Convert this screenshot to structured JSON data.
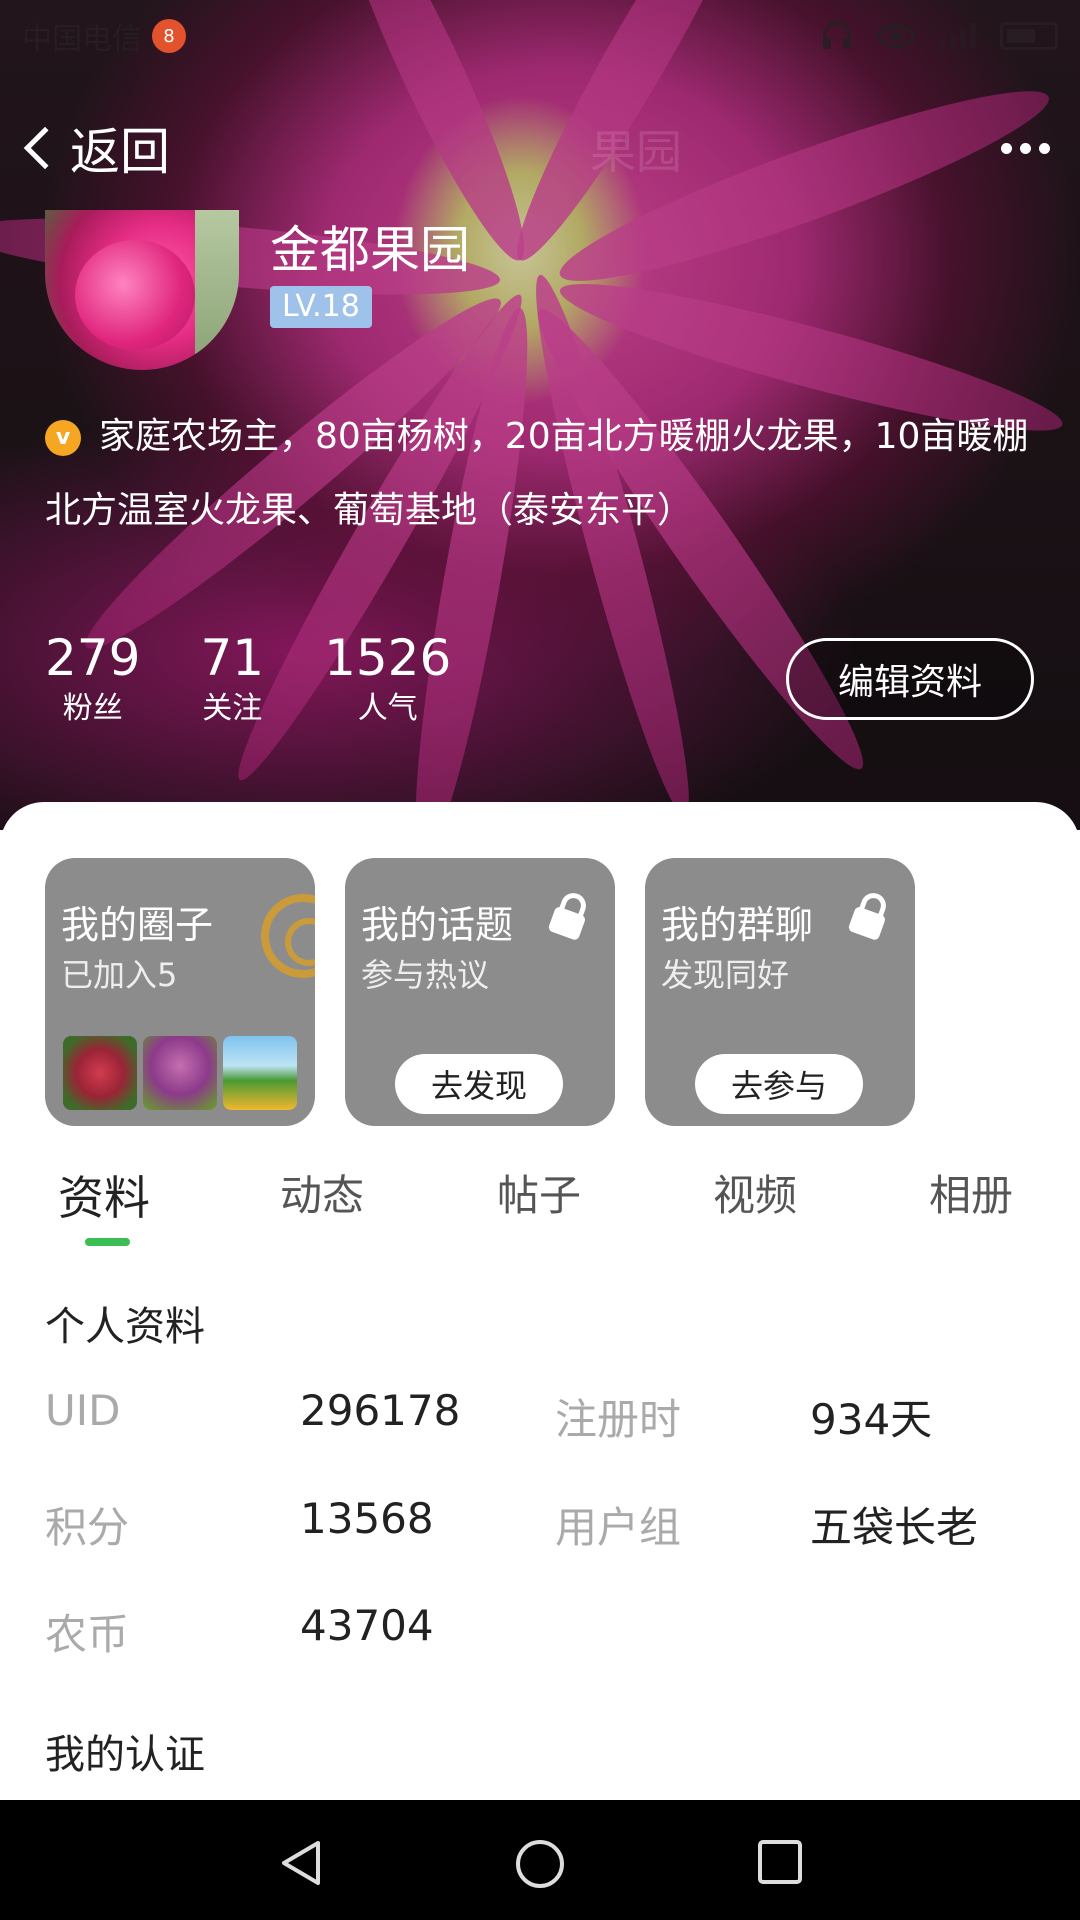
{
  "status_bar": {
    "carrier": "中国电信",
    "carrier_badge": "8"
  },
  "nav": {
    "back_label": "返回",
    "ghost_title": "果园"
  },
  "profile": {
    "name": "金都果园",
    "level": "LV.18",
    "bio_line1": "家庭农场主，80亩杨树，20亩北方暖棚火龙果，10亩暖棚",
    "bio_line2": "北方温室火龙果、葡萄基地（泰安东平）",
    "stats": [
      {
        "value": "279",
        "label": "粉丝"
      },
      {
        "value": "71",
        "label": "关注"
      },
      {
        "value": "1526",
        "label": "人气"
      }
    ],
    "edit_label": "编辑资料"
  },
  "cards": [
    {
      "title": "我的圈子",
      "subtitle": "已加入5"
    },
    {
      "title": "我的话题",
      "subtitle": "参与热议",
      "button": "去发现"
    },
    {
      "title": "我的群聊",
      "subtitle": "发现同好",
      "button": "去参与"
    }
  ],
  "tabs": [
    {
      "label": "资料",
      "active": true
    },
    {
      "label": "动态"
    },
    {
      "label": "帖子"
    },
    {
      "label": "视频"
    },
    {
      "label": "相册"
    }
  ],
  "personal_info": {
    "title": "个人资料",
    "rows": [
      {
        "k1": "UID",
        "v1": "296178",
        "k2": "注册时",
        "v2": "934天"
      },
      {
        "k1": "积分",
        "v1": "13568",
        "k2": "用户组",
        "v2": "五袋长老"
      },
      {
        "k1": "农币",
        "v1": "43704",
        "k2": "",
        "v2": ""
      }
    ]
  },
  "certification": {
    "title": "我的认证"
  },
  "colors": {
    "accent": "#3bbf55",
    "level_badge": "#9fc2ea",
    "card_bg": "#8c8c8c",
    "verified": "#f5a623"
  }
}
